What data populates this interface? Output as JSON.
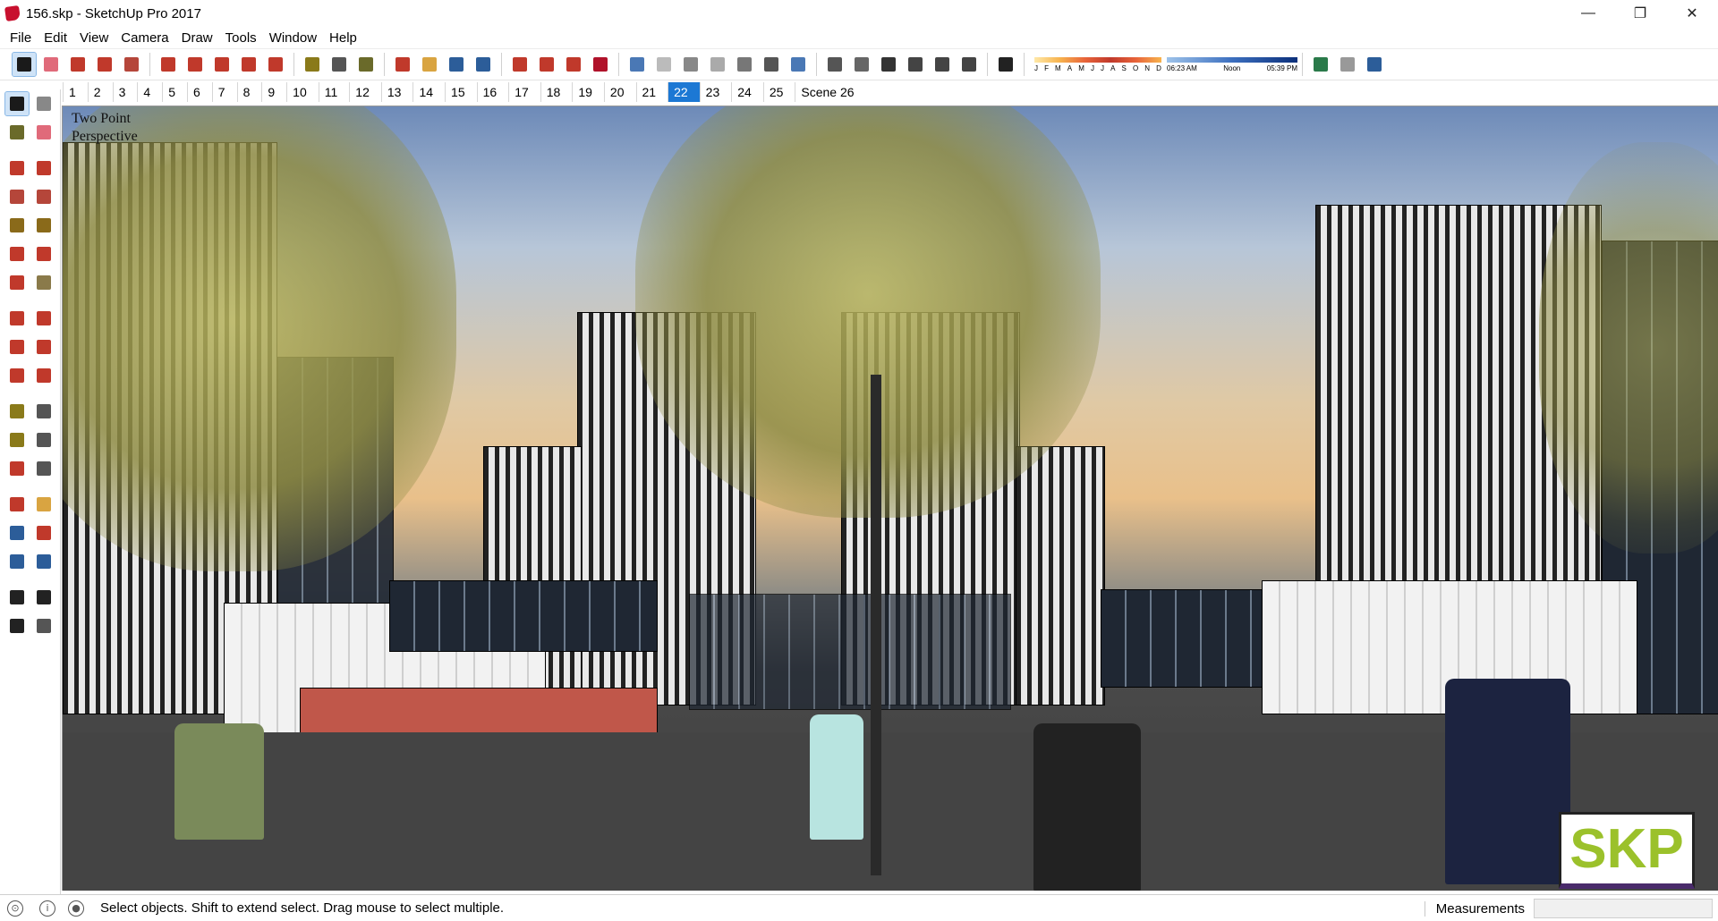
{
  "window": {
    "title": "156.skp - SketchUp Pro 2017",
    "controls": {
      "minimize": "—",
      "maximize": "❐",
      "close": "✕"
    }
  },
  "menu": [
    "File",
    "Edit",
    "View",
    "Camera",
    "Draw",
    "Tools",
    "Window",
    "Help"
  ],
  "toolbar": {
    "groups": [
      [
        "select-icon",
        "eraser-icon",
        "pencil-icon",
        "arc-icon",
        "rectangle-icon"
      ],
      [
        "push-pull-icon",
        "follow-me-icon",
        "move-icon",
        "rotate-icon",
        "scale-icon"
      ],
      [
        "tape-measure-icon",
        "text-icon",
        "paint-bucket-icon"
      ],
      [
        "orbit-icon",
        "pan-icon",
        "zoom-icon",
        "zoom-extents-icon"
      ],
      [
        "warehouse-icon",
        "extension-icon",
        "send-to-layout-icon",
        "ruby-icon"
      ],
      [
        "xray-icon",
        "back-edges-icon",
        "wireframe-icon",
        "hidden-line-icon",
        "shaded-icon",
        "shaded-textures-icon",
        "monochrome-icon"
      ],
      [
        "iso-view-icon",
        "top-view-icon",
        "front-view-icon",
        "right-view-icon",
        "back-view-icon",
        "left-view-icon"
      ],
      [
        "shadows-icon"
      ]
    ],
    "months": [
      "J",
      "F",
      "M",
      "A",
      "M",
      "J",
      "J",
      "A",
      "S",
      "O",
      "N",
      "D"
    ],
    "time_start": "06:23 AM",
    "time_mid": "Noon",
    "time_end": "05:39 PM",
    "extra": [
      "geo-location-icon",
      "section-icon",
      "download-icon"
    ]
  },
  "scenes": [
    "1",
    "2",
    "3",
    "4",
    "5",
    "6",
    "7",
    "8",
    "9",
    "10",
    "11",
    "12",
    "13",
    "14",
    "15",
    "16",
    "17",
    "18",
    "19",
    "20",
    "21",
    "22",
    "23",
    "24",
    "25",
    "Scene 26"
  ],
  "active_scene": "22",
  "left_tools": [
    [
      "select-icon",
      "component-icon"
    ],
    [
      "paint-bucket-icon",
      "eraser-icon"
    ],
    [
      "line-icon",
      "freehand-icon"
    ],
    [
      "rectangle-icon",
      "rotated-rectangle-icon"
    ],
    [
      "circle-icon",
      "polygon-icon"
    ],
    [
      "arc-icon",
      "two-point-arc-icon"
    ],
    [
      "three-point-arc-icon",
      "pie-icon"
    ],
    [
      "move-icon",
      "push-pull-icon"
    ],
    [
      "rotate-icon",
      "follow-me-icon"
    ],
    [
      "scale-icon",
      "offset-icon"
    ],
    [
      "tape-measure-icon",
      "dimension-icon"
    ],
    [
      "protractor-icon",
      "text-icon"
    ],
    [
      "axes-icon",
      "3d-text-icon"
    ],
    [
      "orbit-icon",
      "pan-icon"
    ],
    [
      "zoom-icon",
      "zoom-window-icon"
    ],
    [
      "zoom-extents-icon",
      "previous-view-icon"
    ],
    [
      "position-camera-icon",
      "look-around-icon"
    ],
    [
      "walk-icon",
      "section-plane-icon"
    ]
  ],
  "viewport": {
    "label_line1": "Two Point",
    "label_line2": "Perspective",
    "logo_text": "SKP"
  },
  "status": {
    "message": "Select objects. Shift to extend select. Drag mouse to select multiple.",
    "measurements_label": "Measurements",
    "measurements_value": ""
  }
}
